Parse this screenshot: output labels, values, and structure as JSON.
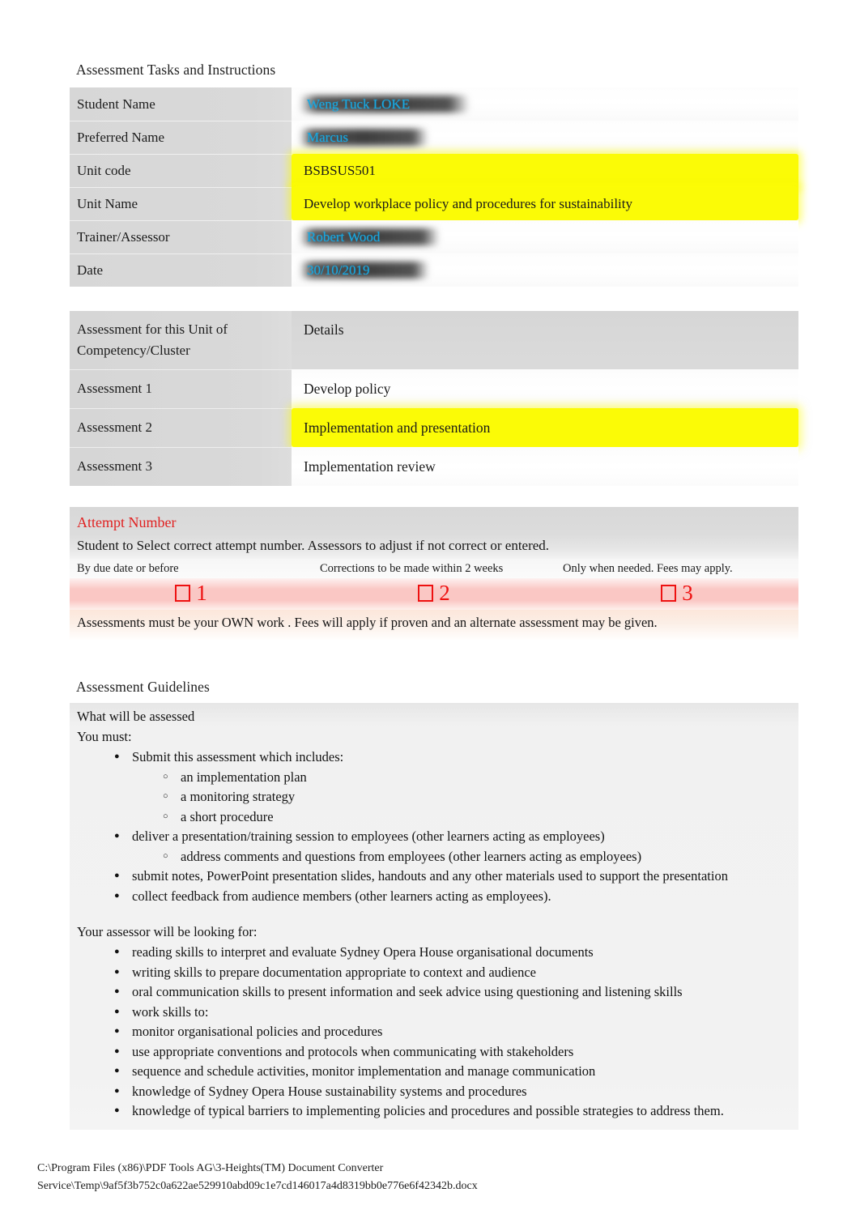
{
  "document": {
    "title": "Assessment Tasks and Instructions"
  },
  "info_table": {
    "rows": [
      {
        "label": "Student Name",
        "value": "Weng Tuck LOKE",
        "style": "redacted"
      },
      {
        "label": "Preferred Name",
        "value": "Marcus",
        "style": "redacted"
      },
      {
        "label": "Unit code",
        "value": "BSBSUS501",
        "style": "highlight"
      },
      {
        "label": "Unit Name",
        "value": "Develop workplace policy and procedures for sustainability",
        "style": "highlight"
      },
      {
        "label": "Trainer/Assessor",
        "value": "Robert Wood",
        "style": "redacted"
      },
      {
        "label": "Date",
        "value": "30/10/2019",
        "style": "redacted"
      }
    ]
  },
  "detail_table": {
    "header": {
      "label": "Assessment for this Unit of Competency/Cluster",
      "value": "Details"
    },
    "rows": [
      {
        "label": "Assessment 1",
        "value": "Develop policy",
        "style": "plain"
      },
      {
        "label": "Assessment 2",
        "value": "Implementation and presentation",
        "style": "highlight"
      },
      {
        "label": "Assessment 3",
        "value": "Implementation review",
        "style": "plain"
      }
    ]
  },
  "attempt": {
    "title": "Attempt Number",
    "subtitle": "Student to Select correct attempt number. Assessors to adjust if not correct or entered.",
    "columns": [
      {
        "note": "By due date or before",
        "number": "1"
      },
      {
        "note": "Corrections to be made within 2 weeks",
        "number": "2"
      },
      {
        "note": "Only when needed. Fees may apply.",
        "number": "3"
      }
    ],
    "footnote": "Assessments  must be your OWN work . Fees will apply if proven and an alternate assessment may be given."
  },
  "guidelines": {
    "heading": "Assessment Guidelines",
    "what_header": "What will be assessed",
    "you_must": "You must:",
    "must_items": [
      "Submit this assessment which includes:",
      "deliver a presentation/training session to employees (other learners acting as employees)",
      "submit notes, PowerPoint presentation slides, handouts and any other materials used to support the presentation",
      "collect feedback from audience members (other learners acting as employees)."
    ],
    "must_sub_1": [
      "an implementation plan",
      "a monitoring strategy",
      "a short procedure"
    ],
    "must_sub_2": [
      "address comments and questions from employees (other learners acting as employees)"
    ],
    "assessor_lead": "Your assessor will be looking for:",
    "assessor_items": [
      "reading skills to interpret and evaluate Sydney Opera House organisational documents",
      "writing skills to prepare documentation appropriate to context and audience",
      "oral communication skills to present information and seek advice using questioning and listening skills",
      "work skills to:",
      "monitor organisational policies and procedures",
      "use appropriate conventions and protocols when communicating with stakeholders",
      "sequence and schedule activities, monitor implementation and manage communication",
      "knowledge of Sydney Opera House sustainability systems and procedures",
      "knowledge of typical barriers to implementing policies and procedures and possible strategies to address them."
    ]
  },
  "footer": {
    "line1": "C:\\Program Files (x86)\\PDF Tools AG\\3-Heights(TM) Document Converter",
    "line2": "Service\\Temp\\9af5f3b752c0a622ae529910abd09c1e7cd146017a4d8319bb0e776e6f42342b.docx"
  },
  "colors": {
    "highlight_yellow": "#fbfb06",
    "redacted_text": "#18a7e0",
    "attempt_red": "#ee1111",
    "label_gray": "#d9d9d9"
  }
}
